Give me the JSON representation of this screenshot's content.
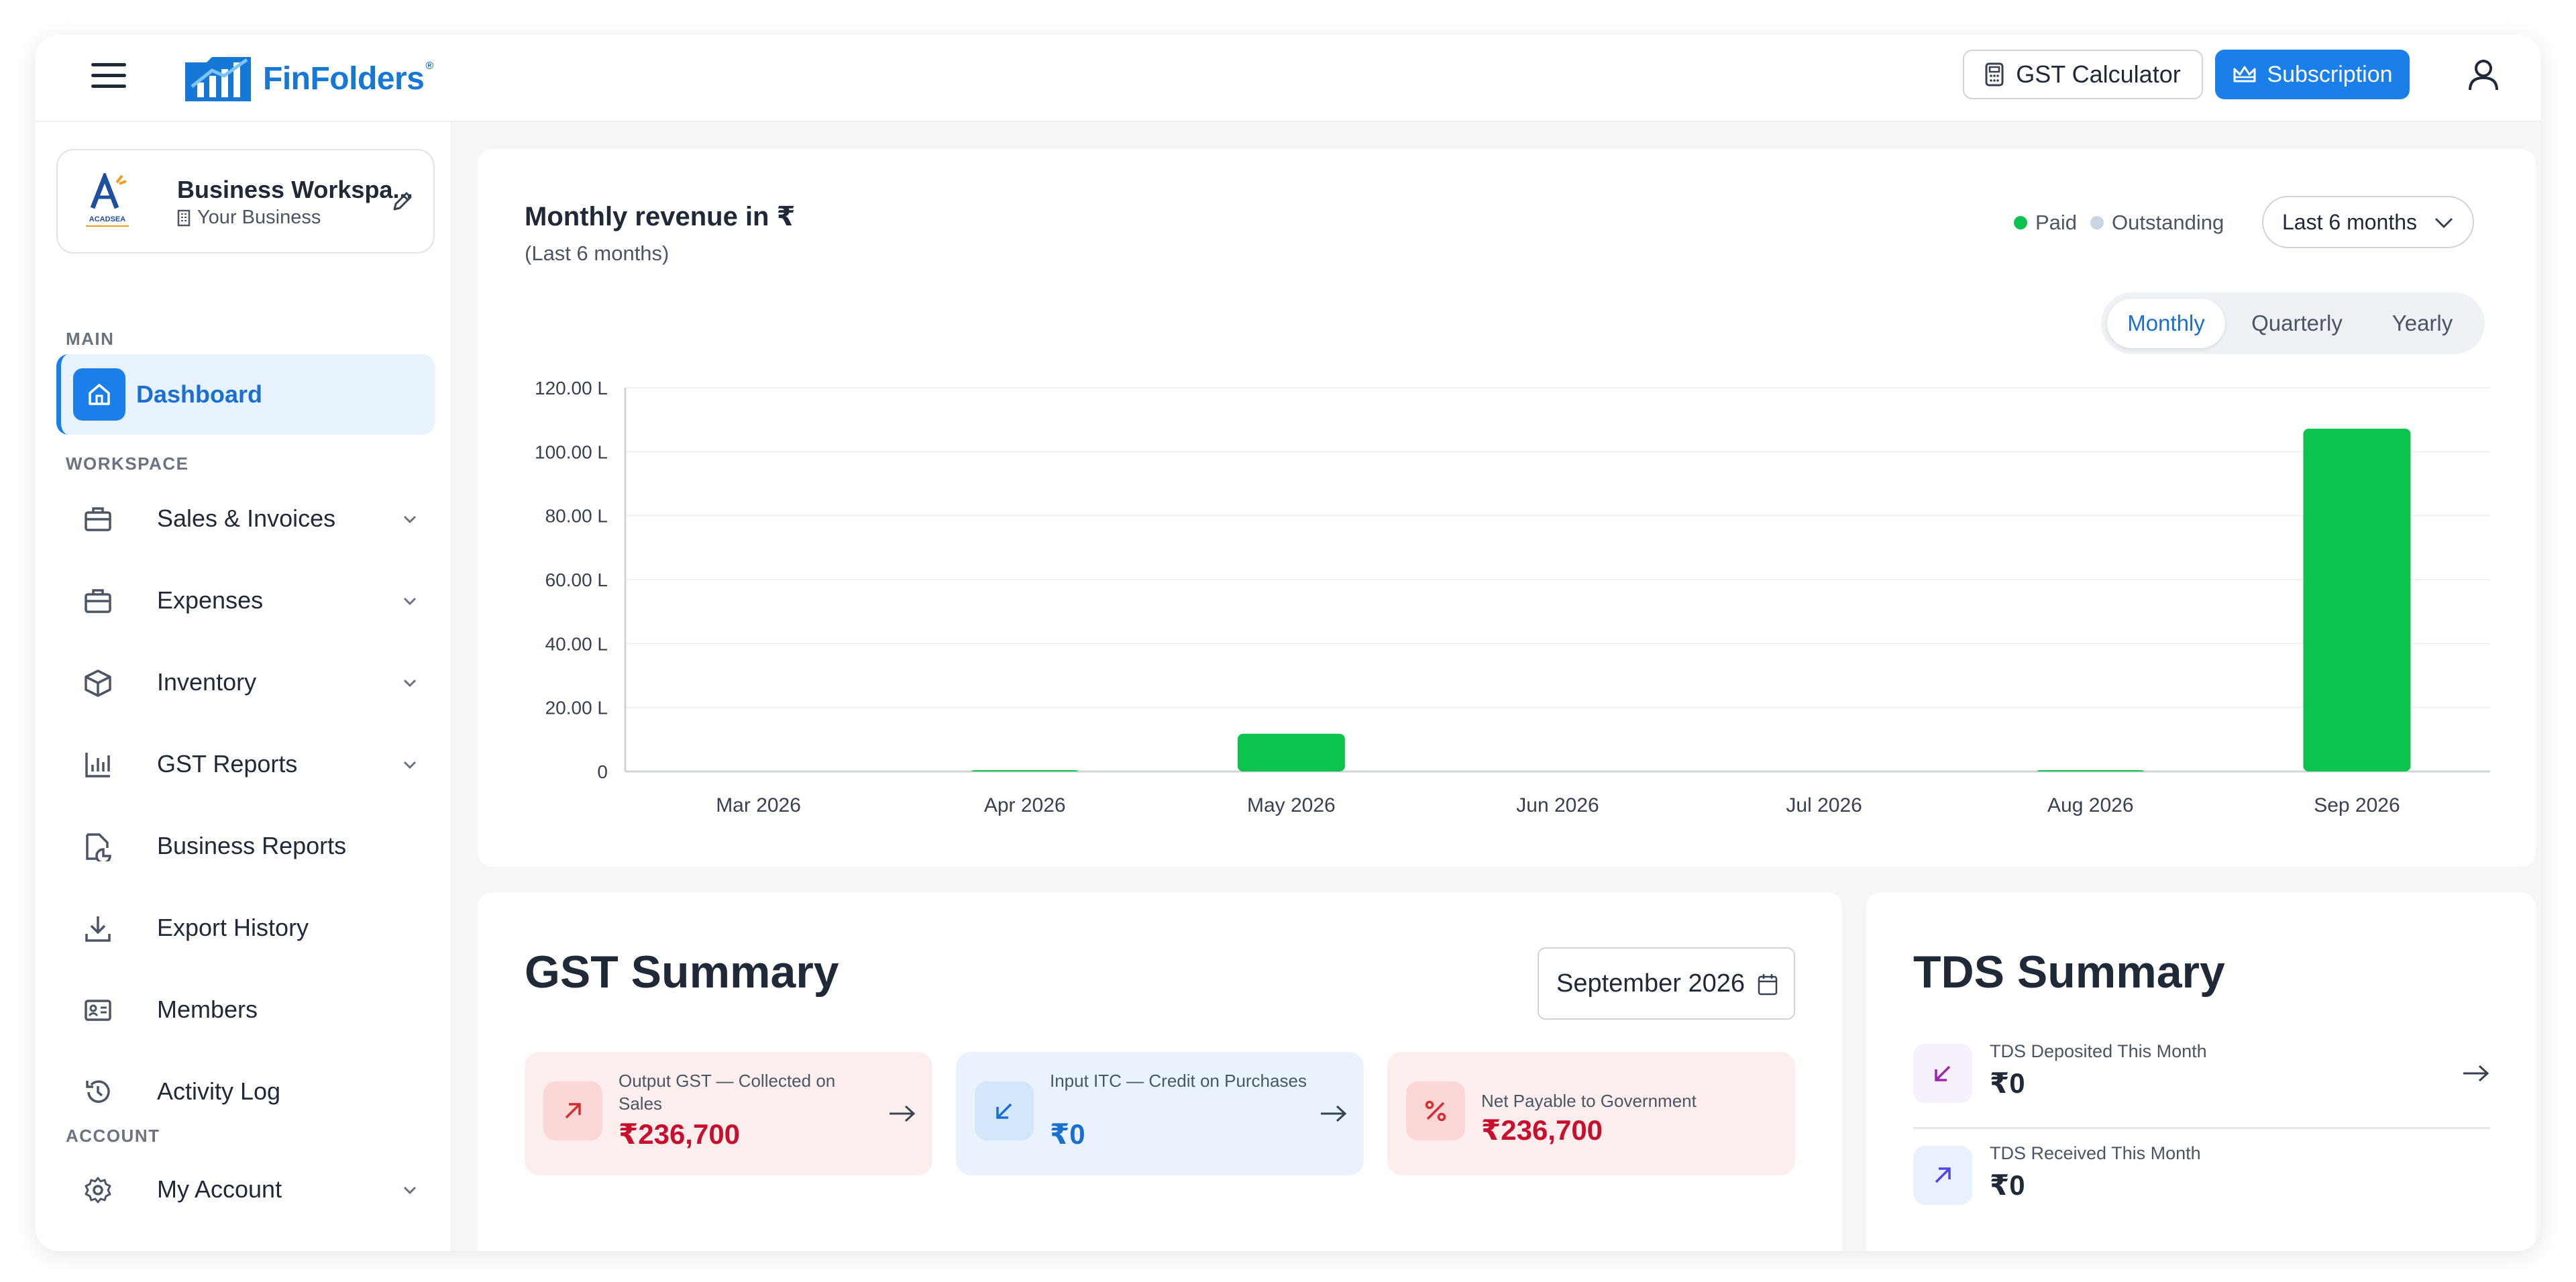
{
  "brand": {
    "name": "FinFolders",
    "mark": "®",
    "color": "#1577d6"
  },
  "header": {
    "gst_calculator_label": "GST Calculator",
    "subscription_label": "Subscription"
  },
  "workspace": {
    "name": "Business Workspa...",
    "type": "Your Business",
    "logo_text": "ACADSEA"
  },
  "sidebar": {
    "sections": {
      "main": "MAIN",
      "workspace": "WORKSPACE",
      "account": "ACCOUNT"
    },
    "dashboard": "Dashboard",
    "items": [
      {
        "label": "Sales & Invoices",
        "icon": "briefcase-icon",
        "has_chevron": true
      },
      {
        "label": "Expenses",
        "icon": "wallet-icon",
        "has_chevron": true
      },
      {
        "label": "Inventory",
        "icon": "box-icon",
        "has_chevron": true
      },
      {
        "label": "GST Reports",
        "icon": "bar-chart-icon",
        "has_chevron": true
      },
      {
        "label": "Business Reports",
        "icon": "pie-chart-icon",
        "has_chevron": false
      },
      {
        "label": "Export History",
        "icon": "download-icon",
        "has_chevron": false
      },
      {
        "label": "Members",
        "icon": "id-card-icon",
        "has_chevron": false
      },
      {
        "label": "Activity Log",
        "icon": "history-icon",
        "has_chevron": false
      }
    ],
    "my_account": "My Account"
  },
  "revenue": {
    "title": "Monthly revenue in ₹",
    "subtitle": "(Last 6 months)",
    "legend": {
      "paid": "Paid",
      "outstanding": "Outstanding"
    },
    "period_select": "Last 6 months",
    "granularity": {
      "monthly": "Monthly",
      "quarterly": "Quarterly",
      "yearly": "Yearly",
      "active": "Monthly"
    }
  },
  "chart_data": {
    "type": "bar",
    "title": "Monthly revenue in ₹",
    "subtitle": "(Last 6 months)",
    "categories": [
      "Mar 2026",
      "Apr 2026",
      "May 2026",
      "Jun 2026",
      "Jul 2026",
      "Aug 2026",
      "Sep 2026"
    ],
    "series": [
      {
        "name": "Paid",
        "color": "#0cc44d",
        "values": [
          0,
          0.2,
          11.8,
          0,
          0,
          0.2,
          107.2
        ]
      },
      {
        "name": "Outstanding",
        "color": "#cbd5e1",
        "values": [
          0,
          0,
          0,
          0,
          0,
          0,
          0
        ]
      }
    ],
    "yticks": [
      "0",
      "20.00 L",
      "40.00 L",
      "60.00 L",
      "80.00 L",
      "100.00 L",
      "120.00 L"
    ],
    "ylim": [
      0,
      120
    ],
    "y_unit": "L",
    "grid": true,
    "legend": "top-right"
  },
  "gst": {
    "title": "GST Summary",
    "month": "September 2026",
    "tiles": [
      {
        "label": "Output GST — Collected on Sales",
        "value": "₹236,700",
        "value_color": "#c8102e",
        "bg": "#fdeeee",
        "icon_bg": "#fbd6d6",
        "icon_color": "#d32f2f"
      },
      {
        "label": "Input ITC — Credit on Purchases",
        "value": "₹0",
        "value_color": "#1a6fd1",
        "bg": "#eaf3fd",
        "icon_bg": "#d3e6fa",
        "icon_color": "#1a6fd1"
      },
      {
        "label": "Net Payable to Government",
        "value": "₹236,700",
        "value_color": "#c8102e",
        "bg": "#fdeeee",
        "icon_bg": "#fbd6d6",
        "icon_color": "#d32f2f"
      }
    ]
  },
  "tds": {
    "title": "TDS Summary",
    "rows": [
      {
        "label": "TDS Deposited This Month",
        "value": "₹0"
      },
      {
        "label": "TDS Received This Month",
        "value": "₹0"
      }
    ]
  }
}
